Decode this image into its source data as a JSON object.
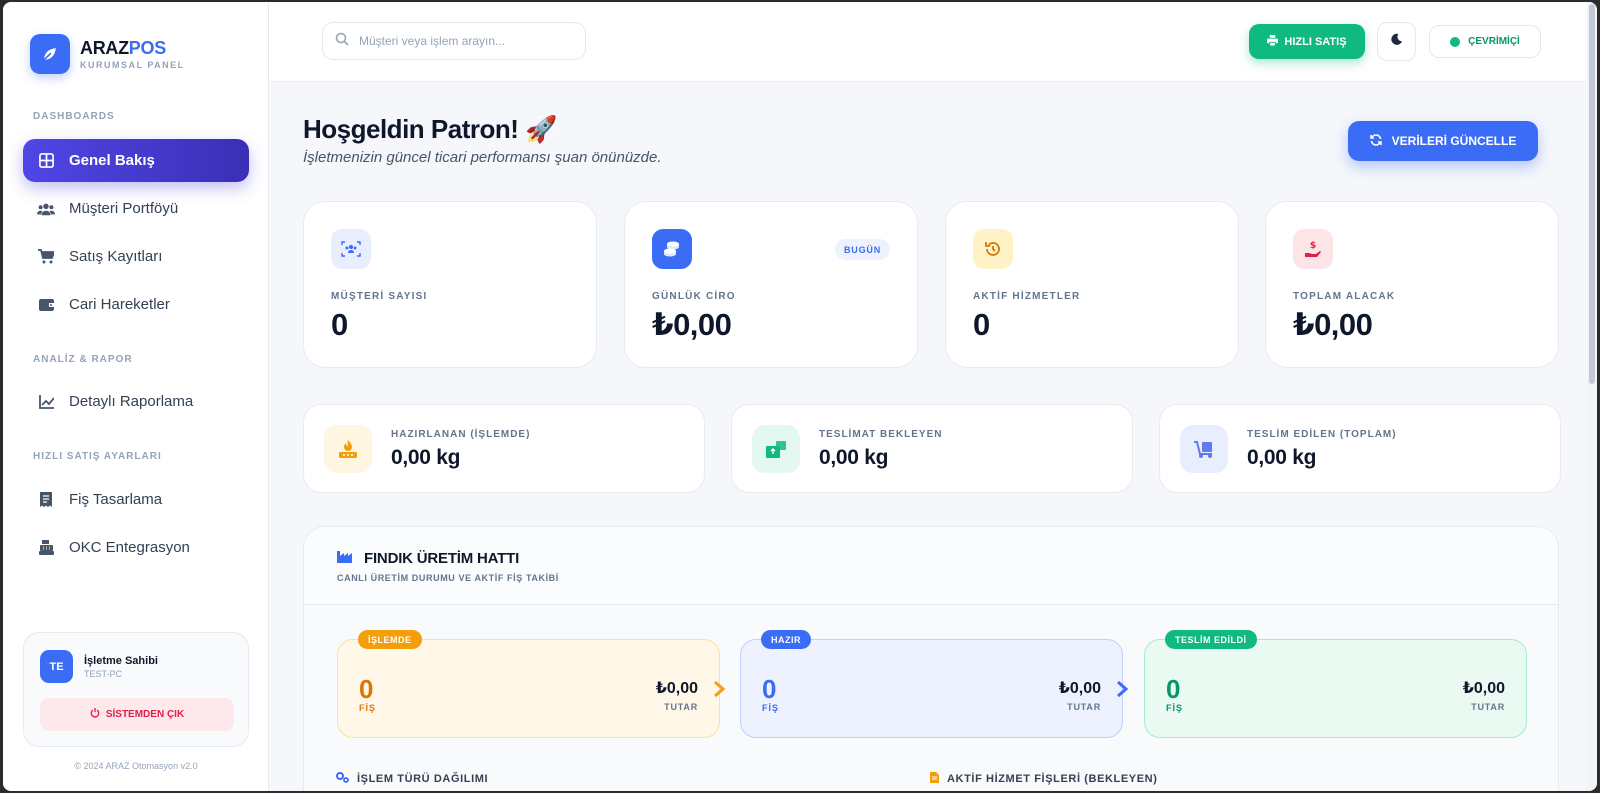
{
  "brand": {
    "name_part1": "ARAZ",
    "name_part2": "POS",
    "subtitle": "KURUMSAL PANEL"
  },
  "sidebar": {
    "sections": [
      {
        "title": "DASHBOARDS"
      },
      {
        "title": "ANALİZ & RAPOR"
      },
      {
        "title": "HIZLI SATIŞ AYARLARI"
      }
    ],
    "items": [
      {
        "label": "Genel Bakış",
        "icon": "grid-icon",
        "active": true
      },
      {
        "label": "Müşteri Portföyü",
        "icon": "users-icon"
      },
      {
        "label": "Satış Kayıtları",
        "icon": "cart-icon"
      },
      {
        "label": "Cari Hareketler",
        "icon": "wallet-icon"
      },
      {
        "label": "Detaylı Raporlama",
        "icon": "chart-line-icon"
      },
      {
        "label": "Fiş Tasarlama",
        "icon": "receipt-icon"
      },
      {
        "label": "OKC Entegrasyon",
        "icon": "cash-register-icon"
      }
    ],
    "user": {
      "initials": "TE",
      "name": "İşletme Sahibi",
      "pc": "TEST-PC"
    },
    "logout_label": "SİSTEMDEN ÇIK",
    "copyright": "© 2024 ARAZ Otomasyon v2.0"
  },
  "topbar": {
    "search_placeholder": "Müşteri veya işlem arayın...",
    "quick_sale_label": "HIZLI SATIŞ",
    "status_label": "ÇEVRİMİÇİ"
  },
  "header": {
    "title": "Hoşgeldin Patron! 🚀",
    "subtitle": "İşletmenizin güncel ticari performansı şuan önünüzde.",
    "refresh_label": "VERİLERİ GÜNCELLE"
  },
  "stats": [
    {
      "label": "MÜŞTERİ SAYISI",
      "value": "0",
      "icon": "users-icon",
      "bg": "#e8eefe",
      "color": "#3b6cf6"
    },
    {
      "label": "GÜNLÜK CİRO",
      "value": "₺0,00",
      "icon": "coins-icon",
      "bg": "#3b6cf6",
      "color": "#ffffff",
      "badge": "BUGÜN"
    },
    {
      "label": "AKTİF HİZMETLER",
      "value": "0",
      "icon": "history-icon",
      "bg": "#fef3c7",
      "color": "#d97706"
    },
    {
      "label": "TOPLAM ALACAK",
      "value": "₺0,00",
      "icon": "hand-money-icon",
      "bg": "#fde4e7",
      "color": "#e11d48"
    }
  ],
  "weights": [
    {
      "label": "HAZIRLANAN (İŞLEMDE)",
      "value": "0,00 kg",
      "icon": "fire-icon",
      "bg": "#fef6e0",
      "color": "#f59e0b"
    },
    {
      "label": "TESLİMAT BEKLEYEN",
      "value": "0,00 kg",
      "icon": "boxes-icon",
      "bg": "#e3f8ee",
      "color": "#10b981"
    },
    {
      "label": "TESLİM EDİLEN (TOPLAM)",
      "value": "0,00 kg",
      "icon": "truck-icon",
      "bg": "#e8eefe",
      "color": "#6478f0"
    }
  ],
  "production": {
    "title": "FINDIK ÜRETİM HATTI",
    "subtitle": "CANLI ÜRETİM DURUMU VE AKTİF FİŞ TAKİBİ",
    "stages": [
      {
        "badge": "İŞLEMDE",
        "count": "0",
        "unit": "FİŞ",
        "amount": "₺0,00",
        "total_label": "TUTAR",
        "accent": "#f59e0b",
        "bg": "#fff8e8",
        "border": "#fbe1a0",
        "countColor": "#d97706"
      },
      {
        "badge": "HAZIR",
        "count": "0",
        "unit": "FİŞ",
        "amount": "₺0,00",
        "total_label": "TUTAR",
        "accent": "#3b6cf6",
        "bg": "#edf2fe",
        "border": "#bfd0fb",
        "countColor": "#3b6cf6"
      },
      {
        "badge": "TESLİM EDİLDİ",
        "count": "0",
        "unit": "FİŞ",
        "amount": "₺0,00",
        "total_label": "TUTAR",
        "accent": "#10b981",
        "bg": "#eafaf2",
        "border": "#a7ecc9",
        "countColor": "#059669"
      }
    ],
    "section_left": "İŞLEM TÜRÜ DAĞILIMI",
    "section_right": "AKTİF HİZMET FİŞLERİ (BEKLEYEN)"
  }
}
